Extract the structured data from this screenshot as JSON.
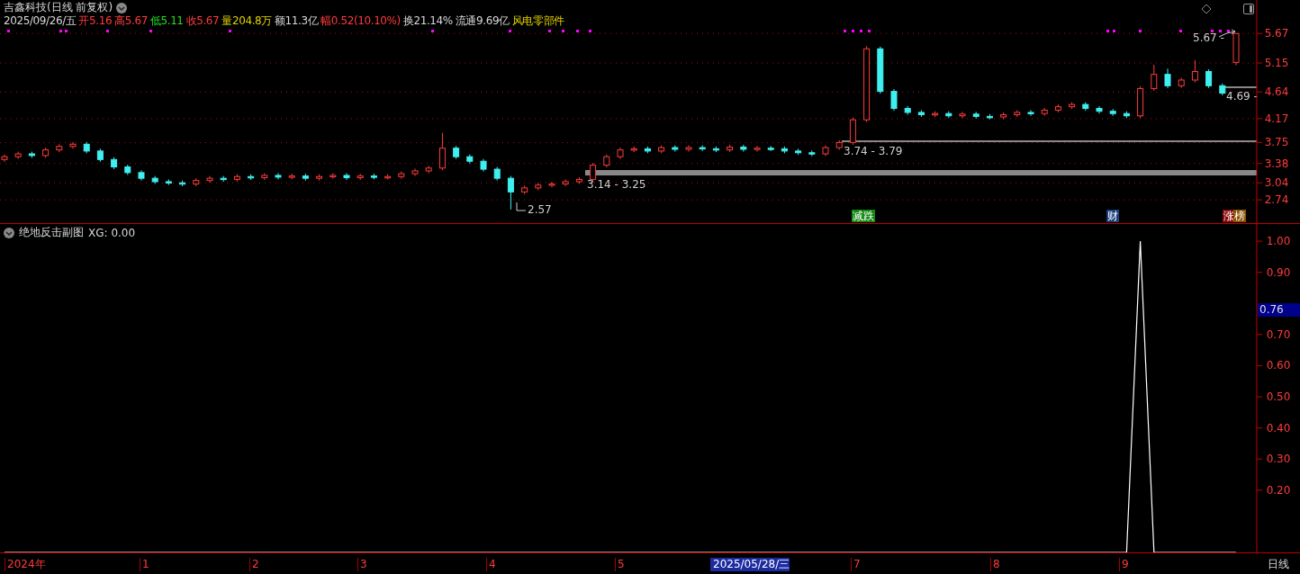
{
  "header": {
    "title": "吉鑫科技(日线 前复权)",
    "date": "2025/09/26/五",
    "quote": [
      {
        "label": "开",
        "value": "5.16",
        "color": "#ff3b3b"
      },
      {
        "label": "高",
        "value": "5.67",
        "color": "#ff3b3b"
      },
      {
        "label": "低",
        "value": "5.11",
        "color": "#22e022"
      },
      {
        "label": "收",
        "value": "5.67",
        "color": "#ff3b3b"
      },
      {
        "label": "量",
        "value": "204.8万",
        "color": "#e0d000"
      },
      {
        "label": "额",
        "value": "11.3亿",
        "color": "#d8d8d8"
      },
      {
        "label": "幅",
        "value": "0.52(10.10%)",
        "color": "#ff3b3b"
      },
      {
        "label": "换",
        "value": "21.14%",
        "color": "#d8d8d8"
      },
      {
        "label": "流通",
        "value": "9.69亿",
        "color": "#d8d8d8"
      },
      {
        "label": "风电零部件",
        "color": "#e0d000"
      }
    ]
  },
  "price_chart": {
    "chart_data": {
      "type": "candlestick",
      "ylim": [
        2.33,
        6.26
      ],
      "grid": true,
      "yticks": [
        {
          "value": 5.67,
          "label": "5.67"
        },
        {
          "value": 5.15,
          "label": "5.15"
        },
        {
          "value": 4.64,
          "label": "4.64"
        },
        {
          "value": 4.17,
          "label": "4.17"
        },
        {
          "value": 3.75,
          "label": "3.75"
        },
        {
          "value": 3.38,
          "label": "3.38"
        },
        {
          "value": 3.04,
          "label": "3.04"
        },
        {
          "value": 2.74,
          "label": "2.74"
        }
      ],
      "categories": [
        null,
        null,
        null,
        null,
        null,
        null,
        null,
        null,
        null,
        null,
        null,
        null,
        null,
        null,
        null,
        null,
        null,
        null,
        null,
        null,
        null,
        null,
        null,
        null,
        null,
        null,
        null,
        null,
        null,
        null,
        null,
        null,
        null,
        null,
        null,
        null,
        null,
        null,
        null,
        null,
        null,
        null,
        null,
        null,
        null,
        null,
        null,
        null,
        null,
        null,
        null,
        null,
        null,
        null,
        null,
        null,
        null,
        null,
        null,
        null,
        null,
        null,
        null,
        null,
        null,
        null,
        null,
        null,
        null,
        null,
        null,
        null,
        null,
        null,
        null,
        null,
        null,
        null,
        null,
        null,
        null,
        null,
        null,
        null,
        null,
        null,
        null,
        null,
        null,
        null,
        null
      ],
      "ohlc": [
        [
          3.45,
          3.54,
          3.41,
          3.5
        ],
        [
          3.5,
          3.59,
          3.46,
          3.55
        ],
        [
          3.55,
          3.59,
          3.48,
          3.52
        ],
        [
          3.52,
          3.66,
          3.48,
          3.62
        ],
        [
          3.62,
          3.72,
          3.58,
          3.68
        ],
        [
          3.68,
          3.76,
          3.64,
          3.72
        ],
        [
          3.72,
          3.76,
          3.56,
          3.6
        ],
        [
          3.6,
          3.64,
          3.41,
          3.45
        ],
        [
          3.45,
          3.49,
          3.28,
          3.32
        ],
        [
          3.32,
          3.36,
          3.18,
          3.22
        ],
        [
          3.22,
          3.26,
          3.08,
          3.12
        ],
        [
          3.12,
          3.16,
          3.02,
          3.06
        ],
        [
          3.06,
          3.1,
          3.0,
          3.04
        ],
        [
          3.04,
          3.08,
          2.98,
          3.02
        ],
        [
          3.02,
          3.12,
          2.98,
          3.08
        ],
        [
          3.08,
          3.16,
          3.04,
          3.12
        ],
        [
          3.12,
          3.16,
          3.06,
          3.1
        ],
        [
          3.1,
          3.19,
          3.06,
          3.15
        ],
        [
          3.15,
          3.19,
          3.09,
          3.13
        ],
        [
          3.13,
          3.21,
          3.09,
          3.17
        ],
        [
          3.17,
          3.21,
          3.1,
          3.14
        ],
        [
          3.14,
          3.2,
          3.1,
          3.16
        ],
        [
          3.16,
          3.2,
          3.08,
          3.12
        ],
        [
          3.12,
          3.19,
          3.08,
          3.15
        ],
        [
          3.15,
          3.21,
          3.11,
          3.17
        ],
        [
          3.17,
          3.21,
          3.09,
          3.13
        ],
        [
          3.13,
          3.2,
          3.09,
          3.16
        ],
        [
          3.16,
          3.2,
          3.1,
          3.14
        ],
        [
          3.14,
          3.19,
          3.1,
          3.15
        ],
        [
          3.15,
          3.24,
          3.11,
          3.2
        ],
        [
          3.2,
          3.29,
          3.16,
          3.25
        ],
        [
          3.25,
          3.34,
          3.21,
          3.3
        ],
        [
          3.3,
          3.92,
          3.26,
          3.65
        ],
        [
          3.65,
          3.69,
          3.46,
          3.5
        ],
        [
          3.5,
          3.54,
          3.38,
          3.42
        ],
        [
          3.42,
          3.46,
          3.24,
          3.28
        ],
        [
          3.28,
          3.32,
          3.08,
          3.12
        ],
        [
          3.12,
          3.16,
          2.57,
          2.88
        ],
        [
          2.88,
          2.99,
          2.84,
          2.95
        ],
        [
          2.95,
          3.04,
          2.91,
          3.0
        ],
        [
          3.0,
          3.06,
          2.96,
          3.02
        ],
        [
          3.02,
          3.1,
          2.98,
          3.06
        ],
        [
          3.06,
          3.14,
          3.02,
          3.1
        ],
        [
          3.1,
          3.39,
          3.06,
          3.35
        ],
        [
          3.35,
          3.54,
          3.31,
          3.5
        ],
        [
          3.5,
          3.66,
          3.46,
          3.62
        ],
        [
          3.62,
          3.68,
          3.58,
          3.64
        ],
        [
          3.64,
          3.68,
          3.56,
          3.6
        ],
        [
          3.6,
          3.7,
          3.56,
          3.66
        ],
        [
          3.66,
          3.7,
          3.59,
          3.63
        ],
        [
          3.63,
          3.7,
          3.59,
          3.66
        ],
        [
          3.66,
          3.7,
          3.6,
          3.64
        ],
        [
          3.64,
          3.68,
          3.58,
          3.62
        ],
        [
          3.62,
          3.71,
          3.58,
          3.67
        ],
        [
          3.67,
          3.71,
          3.59,
          3.63
        ],
        [
          3.63,
          3.69,
          3.59,
          3.65
        ],
        [
          3.65,
          3.69,
          3.6,
          3.64
        ],
        [
          3.64,
          3.68,
          3.56,
          3.6
        ],
        [
          3.6,
          3.64,
          3.53,
          3.57
        ],
        [
          3.57,
          3.61,
          3.51,
          3.55
        ],
        [
          3.55,
          3.7,
          3.51,
          3.66
        ],
        [
          3.66,
          3.79,
          3.62,
          3.75
        ],
        [
          3.75,
          4.19,
          3.71,
          4.15
        ],
        [
          4.15,
          5.45,
          4.11,
          5.4
        ],
        [
          5.4,
          5.44,
          4.61,
          4.65
        ],
        [
          4.65,
          4.69,
          4.31,
          4.35
        ],
        [
          4.35,
          4.39,
          4.24,
          4.28
        ],
        [
          4.28,
          4.32,
          4.2,
          4.24
        ],
        [
          4.24,
          4.3,
          4.2,
          4.26
        ],
        [
          4.26,
          4.3,
          4.18,
          4.22
        ],
        [
          4.22,
          4.29,
          4.18,
          4.25
        ],
        [
          4.25,
          4.29,
          4.17,
          4.21
        ],
        [
          4.21,
          4.25,
          4.16,
          4.2
        ],
        [
          4.2,
          4.28,
          4.16,
          4.24
        ],
        [
          4.24,
          4.32,
          4.2,
          4.28
        ],
        [
          4.28,
          4.32,
          4.22,
          4.26
        ],
        [
          4.26,
          4.36,
          4.22,
          4.32
        ],
        [
          4.32,
          4.42,
          4.28,
          4.38
        ],
        [
          4.38,
          4.46,
          4.34,
          4.42
        ],
        [
          4.42,
          4.46,
          4.31,
          4.35
        ],
        [
          4.35,
          4.39,
          4.26,
          4.3
        ],
        [
          4.3,
          4.34,
          4.22,
          4.26
        ],
        [
          4.26,
          4.3,
          4.18,
          4.22
        ],
        [
          4.22,
          4.74,
          4.18,
          4.7
        ],
        [
          4.7,
          5.12,
          4.66,
          4.95
        ],
        [
          4.95,
          5.05,
          4.71,
          4.75
        ],
        [
          4.75,
          4.89,
          4.71,
          4.85
        ],
        [
          4.85,
          5.2,
          4.81,
          5.0
        ],
        [
          5.0,
          5.04,
          4.71,
          4.75
        ],
        [
          4.75,
          4.79,
          4.58,
          4.62
        ],
        [
          5.16,
          5.67,
          5.11,
          5.67
        ]
      ]
    }
  },
  "price_marks": [
    "3.74 - 3.79",
    "3.14 - 3.25",
    "2.57",
    "5.67 -",
    "4.69 -"
  ],
  "signals": [
    {
      "text": "减跌",
      "color": "#118811"
    },
    {
      "text": "财",
      "color": "#1a3f7a"
    },
    {
      "text": "涨",
      "color": "#8a0a0a"
    },
    {
      "text": "榜",
      "color": "#8a5200"
    }
  ],
  "indicator": {
    "title": "绝地反击副图",
    "reading": "XG: 0.00",
    "current_value": "0.76",
    "chart_data": {
      "type": "line",
      "ylim": [
        0,
        1.058
      ],
      "categories": [
        null,
        null,
        null,
        null,
        null,
        null,
        null,
        null,
        null,
        null,
        null,
        null,
        null,
        null,
        null,
        null,
        null,
        null,
        null,
        null,
        null,
        null,
        null,
        null,
        null,
        null,
        null,
        null,
        null,
        null,
        null,
        null,
        null,
        null,
        null,
        null,
        null,
        null,
        null,
        null,
        null,
        null,
        null,
        null,
        null,
        null,
        null,
        null,
        null,
        null,
        null,
        null,
        null,
        null,
        null,
        null,
        null,
        null,
        null,
        null,
        null,
        null,
        null,
        null,
        null,
        null,
        null,
        null,
        null,
        null,
        null,
        null,
        null,
        null,
        null,
        null,
        null,
        null,
        null,
        null,
        null,
        null,
        null,
        null,
        null,
        null,
        null,
        null,
        null,
        null,
        null
      ],
      "series": [
        {
          "color": "#ffffff",
          "values": [
            0,
            0,
            0,
            0,
            0,
            0,
            0,
            0,
            0,
            0,
            0,
            0,
            0,
            0,
            0,
            0,
            0,
            0,
            0,
            0,
            0,
            0,
            0,
            0,
            0,
            0,
            0,
            0,
            0,
            0,
            0,
            0,
            0,
            0,
            0,
            0,
            0,
            0,
            0,
            0,
            0,
            0,
            0,
            0,
            0,
            0,
            0,
            0,
            0,
            0,
            0,
            0,
            0,
            0,
            0,
            0,
            0,
            0,
            0,
            0,
            0,
            0,
            0,
            0,
            0,
            0,
            0,
            0,
            0,
            0,
            0,
            0,
            0,
            0,
            0,
            0,
            0,
            0,
            0,
            0,
            0,
            0,
            0,
            1,
            0,
            0,
            0,
            0,
            0,
            0,
            0
          ]
        }
      ],
      "yticks": [
        {
          "value": 0.2,
          "label": "0.20"
        },
        {
          "value": 0.3,
          "label": "0.30"
        },
        {
          "value": 0.4,
          "label": "0.40"
        },
        {
          "value": 0.5,
          "label": "0.50"
        },
        {
          "value": 0.6,
          "label": "0.60"
        },
        {
          "value": 0.7,
          "label": "0.70"
        },
        {
          "value": 0.9,
          "label": "0.90"
        },
        {
          "value": 1.0,
          "label": "1.00"
        }
      ]
    }
  },
  "time_axis": [
    {
      "text": "2024年",
      "selected": false
    },
    {
      "text": "1",
      "selected": false
    },
    {
      "text": "2",
      "selected": false
    },
    {
      "text": "3",
      "selected": false
    },
    {
      "text": "4",
      "selected": false
    },
    {
      "text": "5",
      "selected": false
    },
    {
      "text": "2025/05/28/三",
      "selected": true
    },
    {
      "text": "7",
      "selected": false
    },
    {
      "text": "8",
      "selected": false
    },
    {
      "text": "9",
      "selected": false
    }
  ],
  "period": "日线"
}
